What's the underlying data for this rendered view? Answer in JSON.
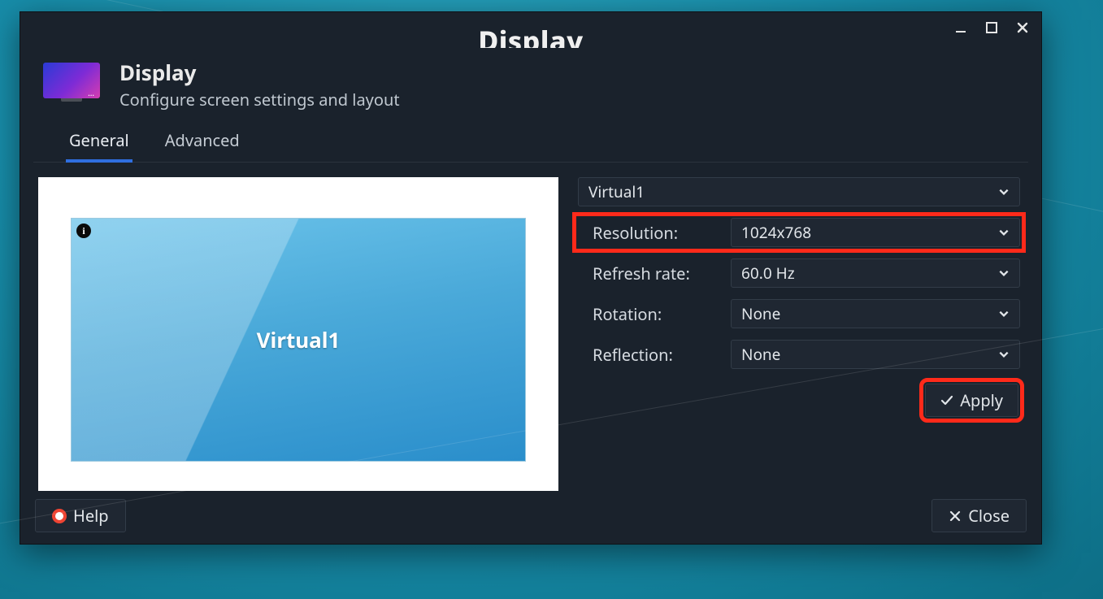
{
  "window": {
    "title": "Display",
    "controls": {
      "minimize": "minimize",
      "maximize": "maximize",
      "close": "close"
    }
  },
  "header": {
    "title": "Display",
    "subtitle": "Configure screen settings and layout"
  },
  "tabs": [
    {
      "label": "General",
      "active": true
    },
    {
      "label": "Advanced",
      "active": false
    }
  ],
  "preview": {
    "display_name": "Virtual1",
    "info_badge": "i"
  },
  "settings": {
    "output_selector": "Virtual1",
    "rows": {
      "resolution": {
        "label": "Resolution:",
        "value": "1024x768"
      },
      "refresh": {
        "label": "Refresh rate:",
        "value": "60.0 Hz"
      },
      "rotation": {
        "label": "Rotation:",
        "value": "None"
      },
      "reflection": {
        "label": "Reflection:",
        "value": "None"
      }
    },
    "apply_label": "Apply"
  },
  "footer": {
    "help_label": "Help",
    "close_label": "Close"
  }
}
